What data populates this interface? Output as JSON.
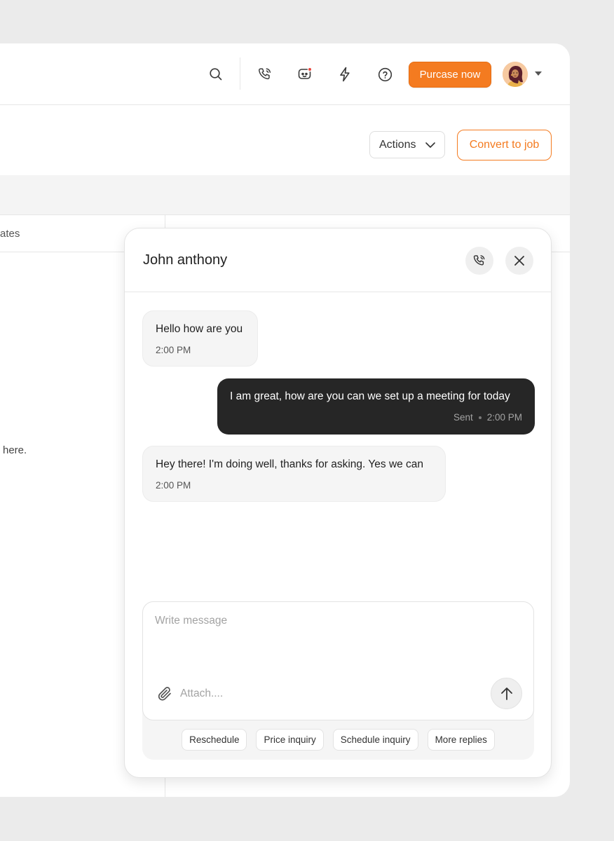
{
  "topbar": {
    "icons": [
      "search-icon",
      "phone-call-icon",
      "chat-bot-icon",
      "lightning-icon",
      "help-icon"
    ],
    "purchase_label": "Purcase now",
    "accent_color": "#f47b20"
  },
  "header": {
    "actions_label": "Actions",
    "convert_label": "Convert to job"
  },
  "background": {
    "tab_partial_label": "ates",
    "body_partial_text": "here."
  },
  "chat": {
    "contact_name": "John anthony",
    "messages": [
      {
        "direction": "incoming",
        "text": "Hello how are you",
        "time": "2:00 PM"
      },
      {
        "direction": "outgoing",
        "text": "I am great, how are you can we set up a meeting for today",
        "status": "Sent",
        "time": "2:00 PM"
      },
      {
        "direction": "incoming",
        "text": "Hey there! I'm doing well, thanks for asking. Yes we can",
        "time": "2:00 PM"
      }
    ],
    "composer": {
      "placeholder": "Write message",
      "attach_label": "Attach...."
    },
    "quick_replies": [
      "Reschedule",
      "Price inquiry",
      "Schedule inquiry",
      "More replies"
    ]
  }
}
